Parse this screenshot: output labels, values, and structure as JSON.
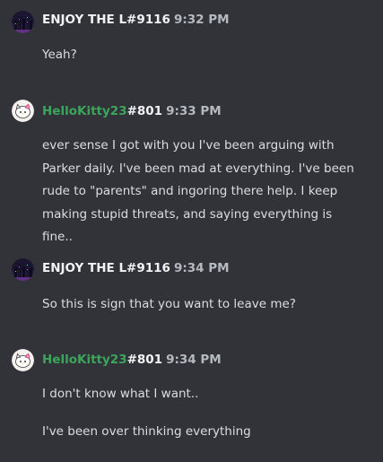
{
  "messages": [
    {
      "username": "ENJOY THE L",
      "discriminator": "#9116",
      "time": "9:32 PM",
      "avatar": "night-city-icon",
      "lines": [
        "Yeah?"
      ]
    },
    {
      "username": "HelloKitty23",
      "discriminator": "#801",
      "time": "9:33 PM",
      "avatar": "hello-kitty-icon",
      "name_color": "#3ba55c",
      "lines": [
        "ever sense I got with you I've been arguing with Parker daily. I've been mad at everything. I've been rude to \"parents\" and ingoring there help. I keep making stupid threats, and saying everything is fine.."
      ]
    },
    {
      "username": "ENJOY THE L",
      "discriminator": "#9116",
      "time": "9:34 PM",
      "avatar": "night-city-icon",
      "lines": [
        "So this is sign that you want to leave me?"
      ]
    },
    {
      "username": "HelloKitty23",
      "discriminator": "#801",
      "time": "9:34 PM",
      "avatar": "hello-kitty-icon",
      "name_color": "#3ba55c",
      "lines": [
        "I don't know what I want..",
        "I've been over thinking everything"
      ]
    }
  ],
  "colors": {
    "background": "#313338",
    "text": "#dbdee1",
    "timestamp": "#b5bac1"
  }
}
